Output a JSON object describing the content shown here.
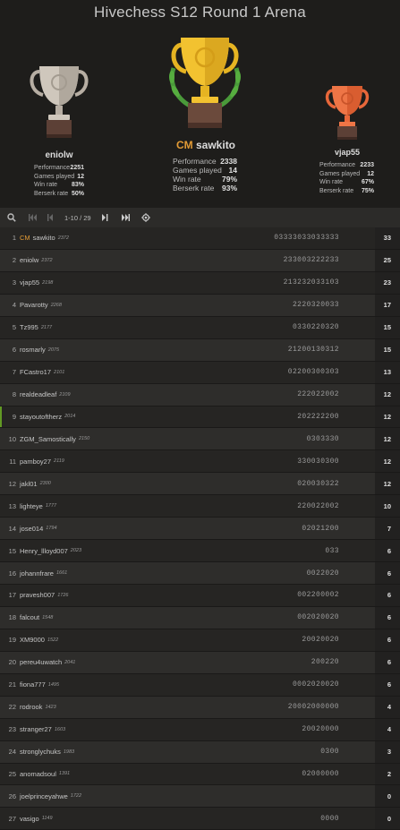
{
  "title": "Hivechess S12 Round 1 Arena",
  "podium": {
    "first": {
      "title": "CM",
      "name": "sawkito",
      "stats": [
        {
          "label": "Performance",
          "value": "2338"
        },
        {
          "label": "Games played",
          "value": "14"
        },
        {
          "label": "Win rate",
          "value": "79%"
        },
        {
          "label": "Berserk rate",
          "value": "93%"
        }
      ]
    },
    "second": {
      "name": "eniolw",
      "stats": [
        {
          "label": "Performance",
          "value": "2251"
        },
        {
          "label": "Games played",
          "value": "12"
        },
        {
          "label": "Win rate",
          "value": "83%"
        },
        {
          "label": "Berserk rate",
          "value": "50%"
        }
      ]
    },
    "third": {
      "name": "vjap55",
      "stats": [
        {
          "label": "Performance",
          "value": "2233"
        },
        {
          "label": "Games played",
          "value": "12"
        },
        {
          "label": "Win rate",
          "value": "67%"
        },
        {
          "label": "Berserk rate",
          "value": "75%"
        }
      ]
    }
  },
  "toolbar": {
    "pages": "1-10 / 29",
    "icons": [
      "search-icon",
      "first-page-icon",
      "prev-page-icon",
      "next-page-icon",
      "last-page-icon",
      "locate-me-icon"
    ]
  },
  "colors": {
    "gold": "#e6b422",
    "silver": "#b7aea3",
    "bronze": "#e8673a",
    "accent": "#e39b35"
  },
  "standings": [
    {
      "rank": "1",
      "title": "CM",
      "name": "sawkito",
      "rating": "2372",
      "sheet": "03333033033333",
      "score": "33"
    },
    {
      "rank": "2",
      "name": "eniolw",
      "rating": "2372",
      "sheet": "233003222233",
      "score": "25"
    },
    {
      "rank": "3",
      "name": "vjap55",
      "rating": "2198",
      "sheet": "213232033103",
      "score": "23"
    },
    {
      "rank": "4",
      "name": "Pavarotty",
      "rating": "2268",
      "sheet": "2220320033",
      "score": "17"
    },
    {
      "rank": "5",
      "name": "Tz995",
      "rating": "2177",
      "sheet": "0330220320",
      "score": "15"
    },
    {
      "rank": "6",
      "name": "rosmarly",
      "rating": "2075",
      "sheet": "21200130312",
      "score": "15"
    },
    {
      "rank": "7",
      "name": "FCastro17",
      "rating": "2101",
      "sheet": "02200300303",
      "score": "13"
    },
    {
      "rank": "8",
      "name": "realdeadleaf",
      "rating": "2109",
      "sheet": "222022002",
      "score": "12"
    },
    {
      "rank": "9",
      "name": "stayoutoftherz",
      "rating": "2014",
      "sheet": "202222200",
      "score": "12"
    },
    {
      "rank": "10",
      "name": "ZGM_Samostically",
      "rating": "2150",
      "sheet": "0303330",
      "score": "12"
    },
    {
      "rank": "11",
      "name": "pamboy27",
      "rating": "2119",
      "sheet": "330030300",
      "score": "12"
    },
    {
      "rank": "12",
      "name": "jakl01",
      "rating": "2300",
      "sheet": "020030322",
      "score": "12"
    },
    {
      "rank": "13",
      "name": "lighteye",
      "rating": "1777",
      "sheet": "220022002",
      "score": "10"
    },
    {
      "rank": "14",
      "name": "jose014",
      "rating": "1794",
      "sheet": "02021200",
      "score": "7"
    },
    {
      "rank": "15",
      "name": "Henry_llloyd007",
      "rating": "2023",
      "sheet": "033",
      "score": "6"
    },
    {
      "rank": "16",
      "name": "johannfrare",
      "rating": "1661",
      "sheet": "0022020",
      "score": "6"
    },
    {
      "rank": "17",
      "name": "pravesh007",
      "rating": "1726",
      "sheet": "002200002",
      "score": "6"
    },
    {
      "rank": "18",
      "name": "falcout",
      "rating": "1548",
      "sheet": "002020020",
      "score": "6"
    },
    {
      "rank": "19",
      "name": "XM9000",
      "rating": "1522",
      "sheet": "20020020",
      "score": "6"
    },
    {
      "rank": "20",
      "name": "pereu4uwatch",
      "rating": "2041",
      "sheet": "200220",
      "score": "6"
    },
    {
      "rank": "21",
      "name": "fiona777",
      "rating": "1495",
      "sheet": "0002020020",
      "score": "6"
    },
    {
      "rank": "22",
      "name": "rodrook",
      "rating": "1423",
      "sheet": "20002000000",
      "score": "4"
    },
    {
      "rank": "23",
      "name": "stranger27",
      "rating": "1603",
      "sheet": "20020000",
      "score": "4"
    },
    {
      "rank": "24",
      "name": "stronglychuks",
      "rating": "1983",
      "sheet": "0300",
      "score": "3"
    },
    {
      "rank": "25",
      "name": "anomadsoul",
      "rating": "1391",
      "sheet": "02000000",
      "score": "2"
    },
    {
      "rank": "26",
      "name": "joelprinceyahwe",
      "rating": "1722",
      "sheet": "",
      "score": "0"
    },
    {
      "rank": "27",
      "name": "vasigo",
      "rating": "1149",
      "sheet": "0000",
      "score": "0"
    }
  ]
}
